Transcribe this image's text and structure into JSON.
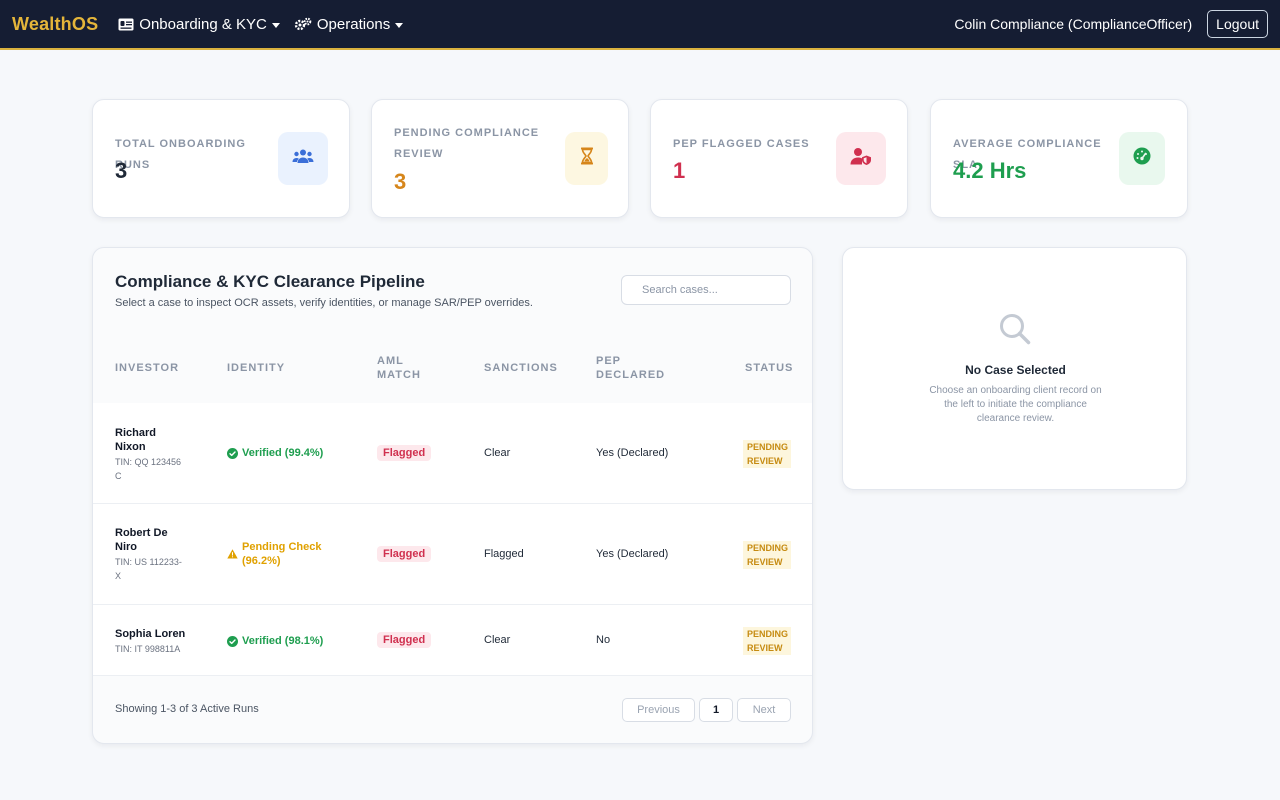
{
  "navbar": {
    "brand": "WealthOS",
    "menus": [
      {
        "label": "Onboarding & KYC",
        "icon": "id-card-icon"
      },
      {
        "label": "Operations",
        "icon": "gears-icon"
      }
    ],
    "user": "Colin Compliance (ComplianceOfficer)",
    "logout_label": "Logout"
  },
  "stats": [
    {
      "label": "Total Onboarding Runs",
      "value": "3",
      "color": "#1f2937",
      "icon": "users-icon",
      "badge_bg": "#eaf2fe",
      "icon_color": "#3b6fd8"
    },
    {
      "label": "Pending Compliance Review",
      "value": "3",
      "color": "#d6861b",
      "icon": "hourglass-icon",
      "badge_bg": "#fdf7e1",
      "icon_color": "#d6861b"
    },
    {
      "label": "PEP Flagged Cases",
      "value": "1",
      "color": "#d0304f",
      "icon": "user-shield-icon",
      "badge_bg": "#fde8ec",
      "icon_color": "#d0304f"
    },
    {
      "label": "Average Compliance SLA",
      "value": "4.2 Hrs",
      "color": "#1e9e4f",
      "icon": "gauge-icon",
      "badge_bg": "#e9f8ee",
      "icon_color": "#1e9e4f"
    }
  ],
  "pipeline": {
    "title": "Compliance & KYC Clearance Pipeline",
    "subtitle": "Select a case to inspect OCR assets, verify identities, or manage SAR/PEP overrides.",
    "search_placeholder": "Search cases...",
    "columns": {
      "investor": "Investor",
      "identity": "Identity",
      "aml_1": "AML",
      "aml_2": "Match",
      "sanctions": "Sanctions",
      "pep_1": "PEP",
      "pep_2": "Declared",
      "status": "Status"
    },
    "rows": [
      {
        "name": "Richard Nixon",
        "tin": "TIN: QQ 123456 C",
        "identity": "Verified (99.4%)",
        "identity_state": "verified",
        "aml": "Flagged",
        "sanctions": "Clear",
        "pep": "Yes (Declared)",
        "status": "PENDING REVIEW"
      },
      {
        "name": "Robert De Niro",
        "tin": "TIN: US 112233-X",
        "identity": "Pending Check (96.2%)",
        "identity_state": "pending",
        "aml": "Flagged",
        "sanctions": "Flagged",
        "pep": "Yes (Declared)",
        "status": "PENDING REVIEW"
      },
      {
        "name": "Sophia Loren",
        "tin": "TIN: IT 998811A",
        "identity": "Verified (98.1%)",
        "identity_state": "verified",
        "aml": "Flagged",
        "sanctions": "Clear",
        "pep": "No",
        "status": "PENDING REVIEW"
      }
    ],
    "footer": "Showing 1-3 of 3 Active Runs",
    "pagination": {
      "previous": "Previous",
      "page": "1",
      "next": "Next"
    }
  },
  "detail": {
    "title": "No Case Selected",
    "description": "Choose an onboarding client record on the left to initiate the compliance clearance review.",
    "icon": "search-icon"
  }
}
